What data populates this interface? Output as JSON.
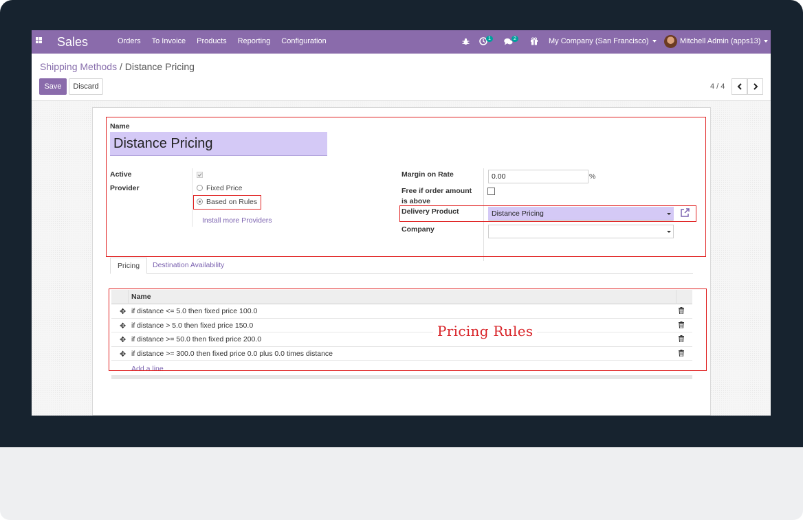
{
  "navbar": {
    "brand": "Sales",
    "menu": [
      "Orders",
      "To Invoice",
      "Products",
      "Reporting",
      "Configuration"
    ],
    "activity_count": "1",
    "messages_count": "2",
    "company": "My Company (San Francisco)",
    "user": "Mitchell Admin (apps13)",
    "icons": [
      "apps-grid-icon",
      "bug-icon",
      "clock-activity-icon",
      "chat-icon",
      "gift-icon"
    ]
  },
  "breadcrumb": {
    "parent": "Shipping Methods",
    "separator": "/",
    "current": "Distance Pricing"
  },
  "buttons": {
    "save": "Save",
    "discard": "Discard"
  },
  "pager": {
    "value": "4 / 4"
  },
  "form": {
    "name_label": "Name",
    "name_value": "Distance Pricing",
    "active_label": "Active",
    "active": true,
    "provider_label": "Provider",
    "provider_options": [
      "Fixed Price",
      "Based on Rules"
    ],
    "provider_selected": "Based on Rules",
    "install_providers": "Install more Providers",
    "margin_label": "Margin on Rate",
    "margin_value": "0.00",
    "margin_unit": "%",
    "free_label_line1": "Free if order amount",
    "free_label_line2": "is above",
    "free_checked": false,
    "delivery_product_label": "Delivery Product",
    "delivery_product_value": "Distance Pricing",
    "company_label": "Company",
    "company_value": ""
  },
  "tabs": [
    "Pricing",
    "Destination Availability"
  ],
  "pricing_table": {
    "column": "Name",
    "rows": [
      "if distance <= 5.0 then fixed price 100.0",
      "if distance > 5.0 then fixed price 150.0",
      "if distance >= 50.0 then fixed price 200.0",
      "if distance >= 300.0 then fixed price 0.0 plus 0.0 times distance"
    ],
    "add_line": "Add a line"
  },
  "annotation": {
    "text": "Pricing  Rules",
    "color": "#e02020"
  },
  "colors": {
    "brand": "#8a6bab",
    "field_highlight": "#d4c9f6",
    "link": "#7c63b0"
  }
}
